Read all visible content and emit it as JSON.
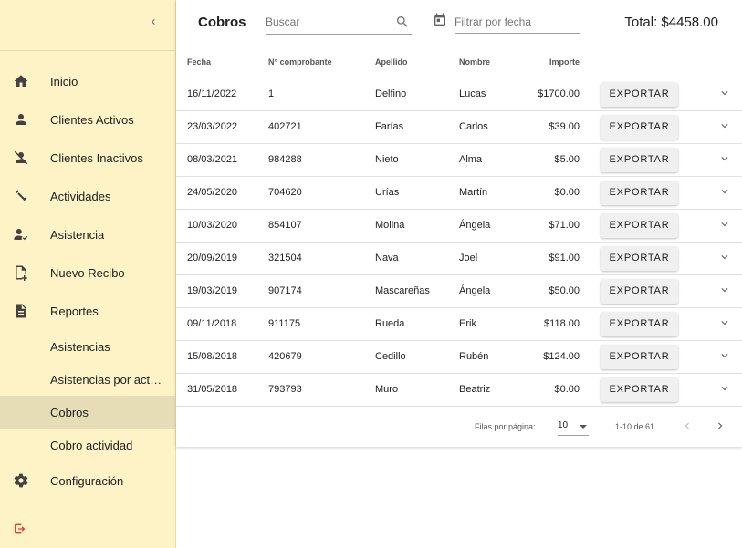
{
  "sidebar": {
    "items": [
      {
        "label": "Inicio",
        "icon": "home-icon"
      },
      {
        "label": "Clientes Activos",
        "icon": "person-icon"
      },
      {
        "label": "Clientes Inactivos",
        "icon": "person-off-icon"
      },
      {
        "label": "Actividades",
        "icon": "fitness-icon"
      },
      {
        "label": "Asistencia",
        "icon": "person-check-icon"
      },
      {
        "label": "Nuevo Recibo",
        "icon": "file-add-icon"
      },
      {
        "label": "Reportes",
        "icon": "document-icon"
      }
    ],
    "subitems": [
      {
        "label": "Asistencias"
      },
      {
        "label": "Asistencias por actividad"
      },
      {
        "label": "Cobros"
      },
      {
        "label": "Cobro actividad"
      }
    ],
    "active_subitem": "Cobros",
    "config_label": "Configuración",
    "colors": {
      "background": "#fdf3c6",
      "active": "#e6dcb6",
      "logout_icon": "#e53935"
    }
  },
  "header": {
    "title": "Cobros",
    "search_placeholder": "Buscar",
    "date_placeholder": "Filtrar por fecha",
    "total": "Total: $4458.00"
  },
  "table": {
    "columns": [
      "Fecha",
      "N° comprobante",
      "Apellido",
      "Nombre",
      "Importe"
    ],
    "export_label": "EXPORTAR",
    "rows": [
      {
        "fecha": "16/11/2022",
        "comprobante": "1",
        "apellido": "Delfino",
        "nombre": "Lucas",
        "importe": "$1700.00"
      },
      {
        "fecha": "23/03/2022",
        "comprobante": "402721",
        "apellido": "Farías",
        "nombre": "Carlos",
        "importe": "$39.00"
      },
      {
        "fecha": "08/03/2021",
        "comprobante": "984288",
        "apellido": "Nieto",
        "nombre": "Alma",
        "importe": "$5.00"
      },
      {
        "fecha": "24/05/2020",
        "comprobante": "704620",
        "apellido": "Urías",
        "nombre": "Martín",
        "importe": "$0.00"
      },
      {
        "fecha": "10/03/2020",
        "comprobante": "854107",
        "apellido": "Molina",
        "nombre": "Ángela",
        "importe": "$71.00"
      },
      {
        "fecha": "20/09/2019",
        "comprobante": "321504",
        "apellido": "Nava",
        "nombre": "Joel",
        "importe": "$91.00"
      },
      {
        "fecha": "19/03/2019",
        "comprobante": "907174",
        "apellido": "Mascareñas",
        "nombre": "Ángela",
        "importe": "$50.00"
      },
      {
        "fecha": "09/11/2018",
        "comprobante": "911175",
        "apellido": "Rueda",
        "nombre": "Erik",
        "importe": "$118.00"
      },
      {
        "fecha": "15/08/2018",
        "comprobante": "420679",
        "apellido": "Cedillo",
        "nombre": "Rubén",
        "importe": "$124.00"
      },
      {
        "fecha": "31/05/2018",
        "comprobante": "793793",
        "apellido": "Muro",
        "nombre": "Beatriz",
        "importe": "$0.00"
      }
    ]
  },
  "pagination": {
    "rows_label": "Filas por página:",
    "rows_value": "10",
    "range": "1-10 de 61"
  }
}
